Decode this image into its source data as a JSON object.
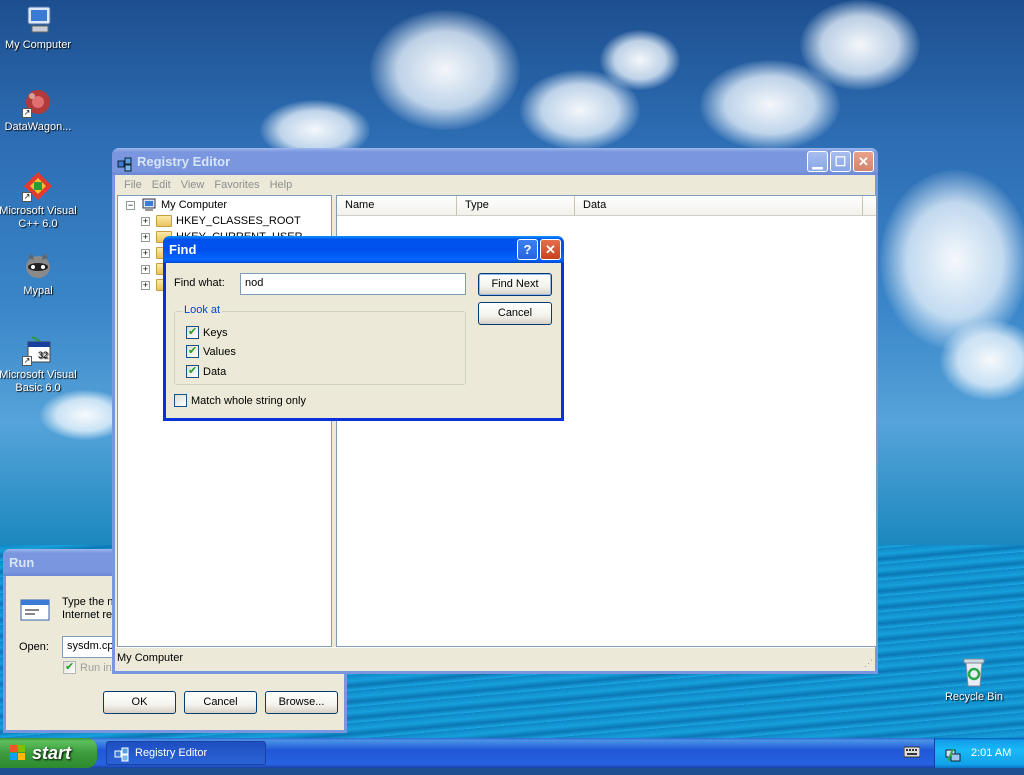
{
  "desktop": {
    "icons": [
      {
        "label": "My Computer"
      },
      {
        "label": "DataWagon..."
      },
      {
        "label": "Microsoft Visual C++ 6.0"
      },
      {
        "label": "Mypal"
      },
      {
        "label": "Microsoft Visual Basic 6.0"
      },
      {
        "label": "Recycle Bin"
      }
    ]
  },
  "run_dialog": {
    "title": "Run",
    "description_line1": "Type the n",
    "description_line2": "Internet re",
    "open_label": "Open:",
    "open_value": "sysdm.cp",
    "checkbox_label": "Run in s",
    "ok_label": "OK",
    "cancel_label": "Cancel",
    "browse_label": "Browse..."
  },
  "registry": {
    "title": "Registry Editor",
    "menu": [
      "File",
      "Edit",
      "View",
      "Favorites",
      "Help"
    ],
    "tree_root": "My Computer",
    "tree_items": [
      "HKEY_CLASSES_ROOT",
      "HKEY_CURRENT_USER"
    ],
    "columns": [
      "Name",
      "Type",
      "Data"
    ],
    "status": "My Computer"
  },
  "find": {
    "title": "Find",
    "find_what_label": "Find what:",
    "find_what_value": "nod",
    "find_next_label": "Find Next",
    "cancel_label": "Cancel",
    "look_at_label": "Look at",
    "keys_label": "Keys",
    "values_label": "Values",
    "data_label": "Data",
    "match_label": "Match whole string only",
    "keys_checked": true,
    "values_checked": true,
    "data_checked": true,
    "match_checked": false
  },
  "taskbar": {
    "start_label": "start",
    "task_label": "Registry Editor",
    "clock": "2:01 AM"
  },
  "colors": {
    "title_active": "#0053ee",
    "title_inactive": "#7a96df",
    "start_green": "#3c9c3c",
    "dialog_face": "#ece9d8"
  }
}
